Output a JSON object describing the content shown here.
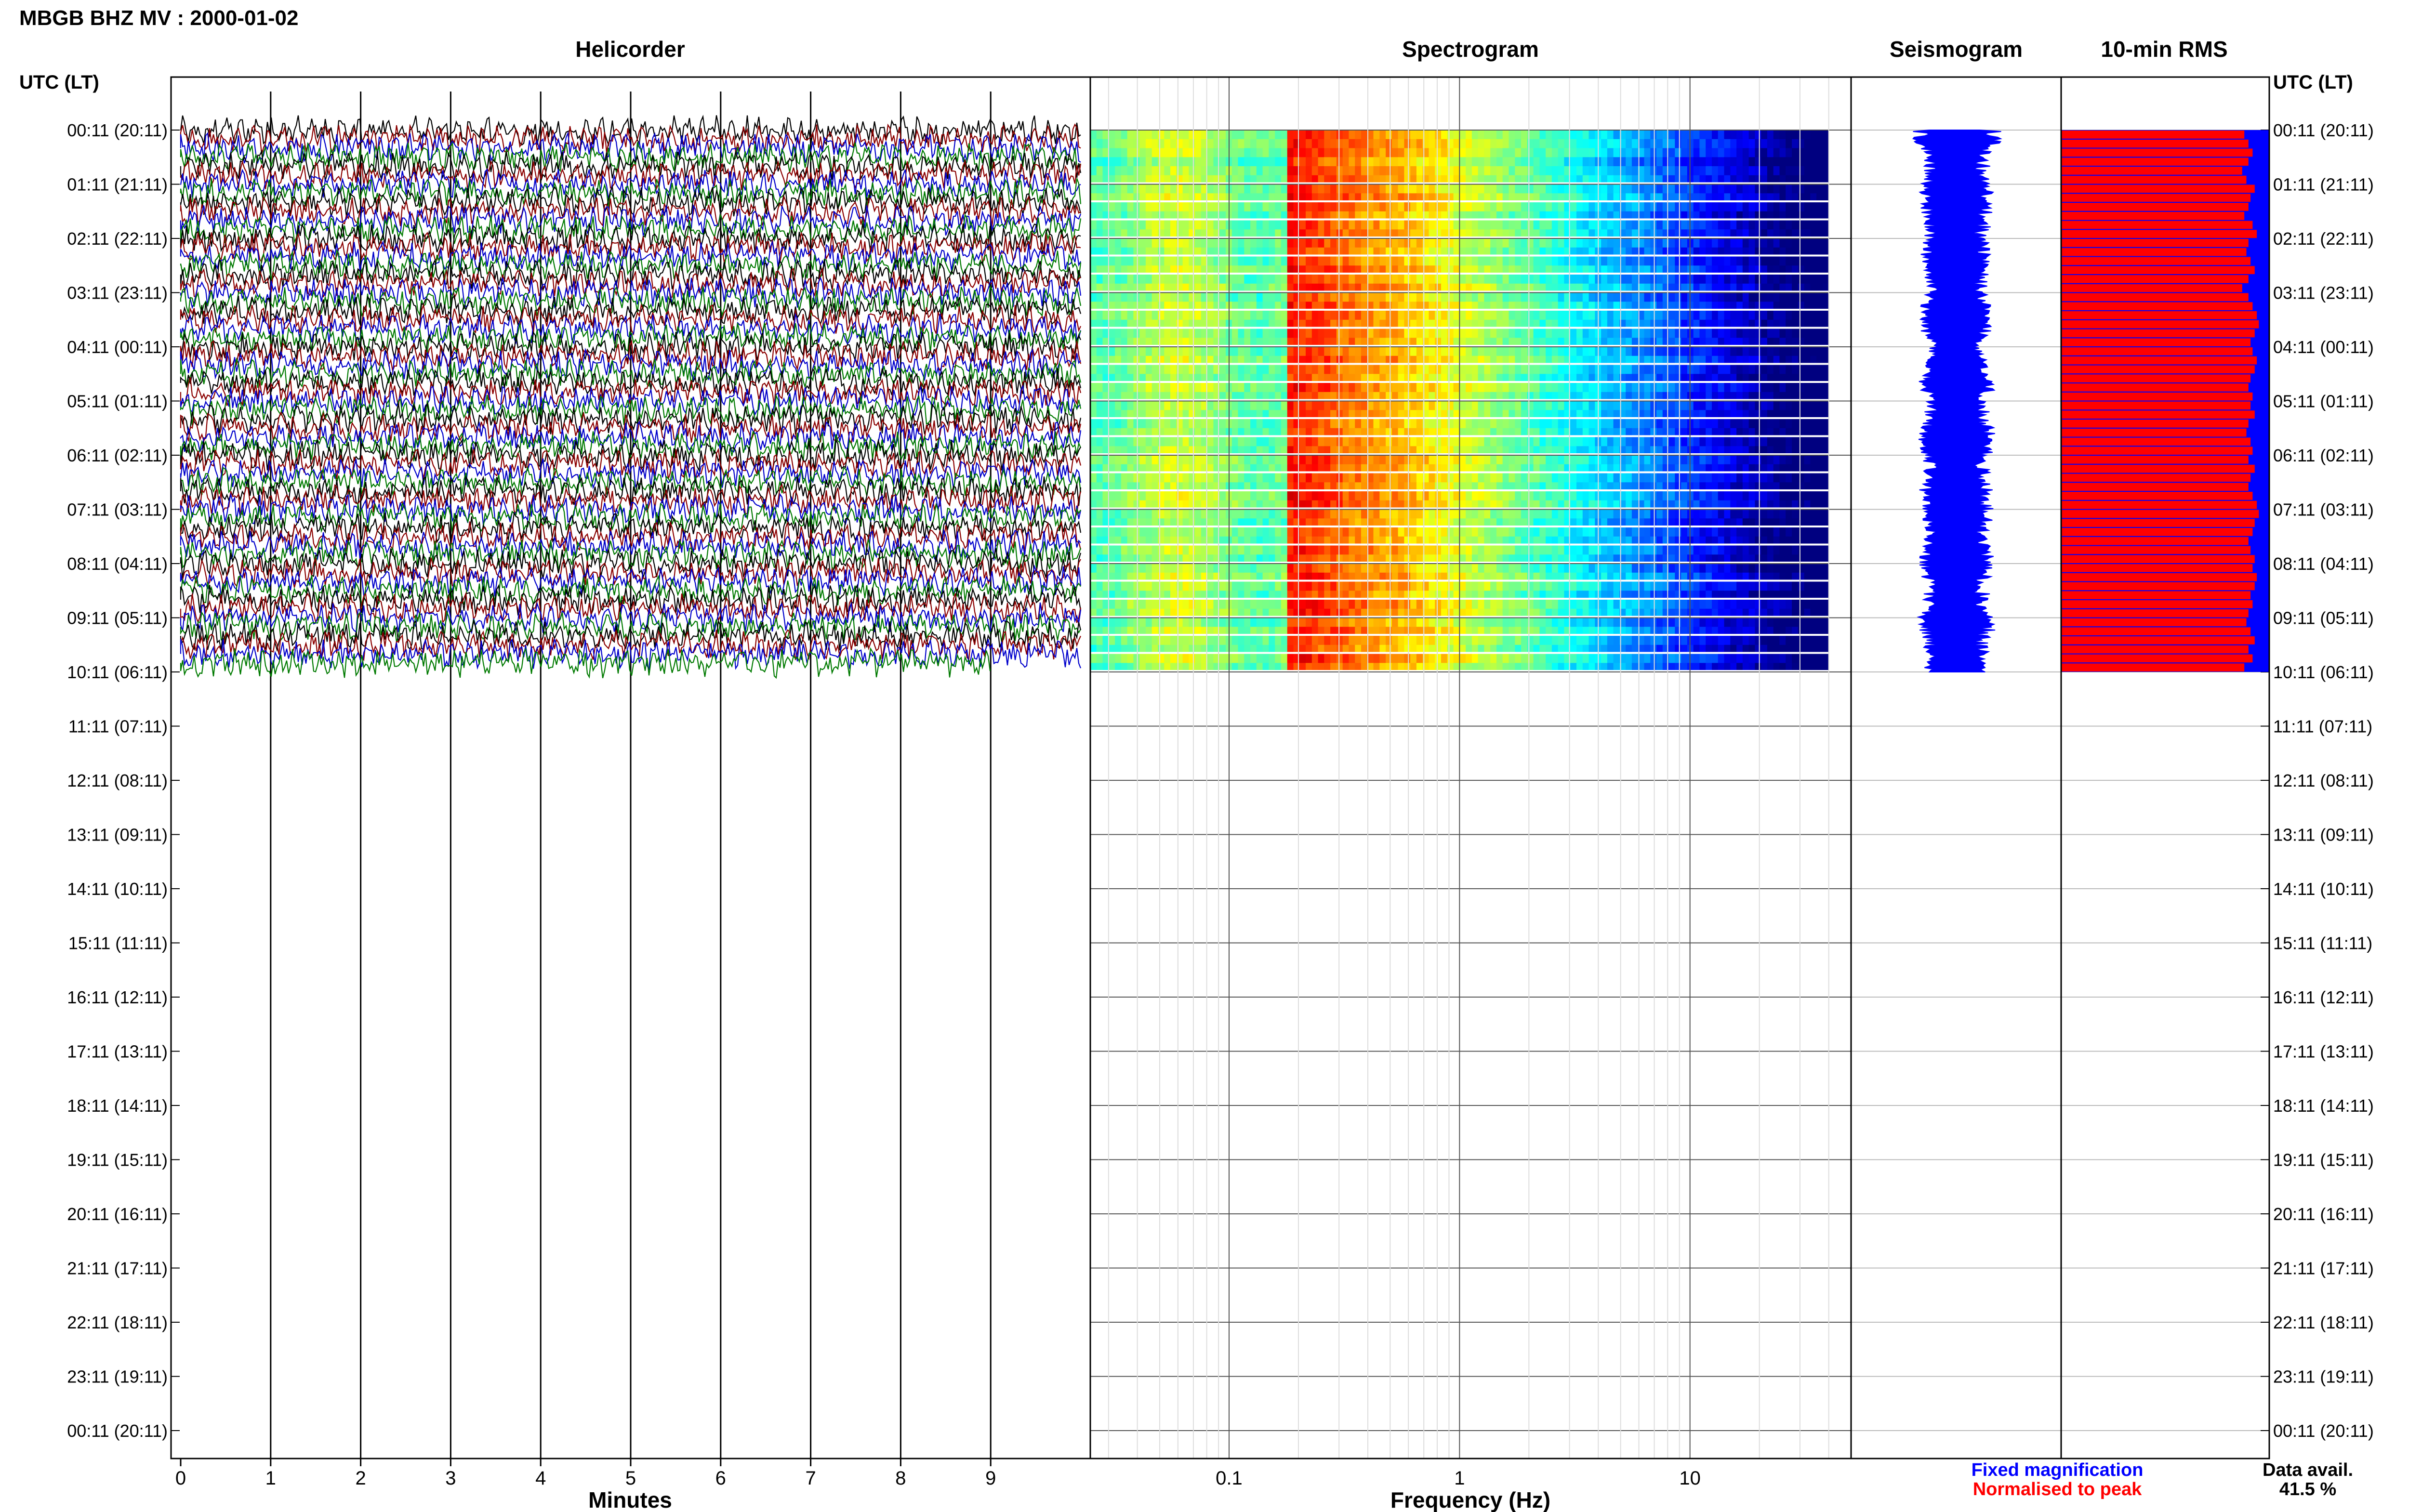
{
  "title": "MBGB BHZ MV : 2000-01-02",
  "left_axis_label": "UTC (LT)",
  "right_axis_label": "UTC (LT)",
  "panels": {
    "helicorder": "Helicorder",
    "spectrogram": "Spectrogram",
    "seismogram": "Seismogram",
    "rms": "10-min RMS"
  },
  "legend": {
    "fixed": "Fixed magnification",
    "fixed_color": "#0000ff",
    "normalised": "Normalised to peak",
    "normalised_color": "#ff0000"
  },
  "data_avail": {
    "label": "Data avail.",
    "value": "41.5 %"
  },
  "chart_data": [
    {
      "type": "line",
      "name": "helicorder",
      "title": "Helicorder",
      "xlabel": "Minutes",
      "x_ticks": [
        "0",
        "1",
        "2",
        "3",
        "4",
        "5",
        "6",
        "7",
        "8",
        "9"
      ],
      "xlim": [
        0,
        10
      ],
      "row_labels": [
        "00:11 (20:11)",
        "01:11 (21:11)",
        "02:11 (22:11)",
        "03:11 (23:11)",
        "04:11 (00:11)",
        "05:11 (01:11)",
        "06:11 (02:11)",
        "07:11 (03:11)",
        "08:11 (04:11)",
        "09:11 (05:11)",
        "10:11 (06:11)",
        "11:11 (07:11)",
        "12:11 (08:11)",
        "13:11 (09:11)",
        "14:11 (10:11)",
        "15:11 (11:11)",
        "16:11 (12:11)",
        "17:11 (13:11)",
        "18:11 (14:11)",
        "19:11 (15:11)",
        "20:11 (16:11)",
        "21:11 (17:11)",
        "22:11 (18:11)",
        "23:11 (19:11)",
        "00:11 (20:11)"
      ],
      "trace_colors": [
        "#000000",
        "#8b0000",
        "#0000cc",
        "#007a00"
      ],
      "traces_per_hour": 6,
      "data_hours": 10
    },
    {
      "type": "heatmap",
      "name": "spectrogram",
      "title": "Spectrogram",
      "xlabel": "Frequency (Hz)",
      "x_scale": "log",
      "xlim": [
        0.025,
        50
      ],
      "x_ticks": [
        "0.1",
        "1",
        "10"
      ],
      "data_fmax": 40,
      "peak_band_hz": [
        0.18,
        0.5
      ],
      "data_hours": 10
    },
    {
      "type": "line",
      "name": "seismogram",
      "title": "Seismogram",
      "color": "#0000ff",
      "data_hours": 10
    },
    {
      "type": "bar",
      "name": "rms",
      "title": "10-min RMS",
      "series": [
        {
          "name": "Normalised to peak",
          "color": "#ff0000"
        },
        {
          "name": "Fixed magnification",
          "color": "#0000ff"
        }
      ],
      "bars": 60,
      "normalised_values": [
        0.88,
        0.9,
        0.92,
        0.9,
        0.87,
        0.89,
        0.93,
        0.91,
        0.9,
        0.88,
        0.92,
        0.94,
        0.9,
        0.89,
        0.91,
        0.93,
        0.9,
        0.87,
        0.9,
        0.92,
        0.94,
        0.95,
        0.93,
        0.91,
        0.92,
        0.94,
        0.93,
        0.91,
        0.9,
        0.92,
        0.91,
        0.93,
        0.9,
        0.89,
        0.91,
        0.92,
        0.9,
        0.93,
        0.91,
        0.9,
        0.92,
        0.94,
        0.95,
        0.93,
        0.92,
        0.9,
        0.91,
        0.93,
        0.92,
        0.94,
        0.93,
        0.91,
        0.92,
        0.9,
        0.89,
        0.91,
        0.93,
        0.9,
        0.92,
        0.88
      ]
    }
  ]
}
